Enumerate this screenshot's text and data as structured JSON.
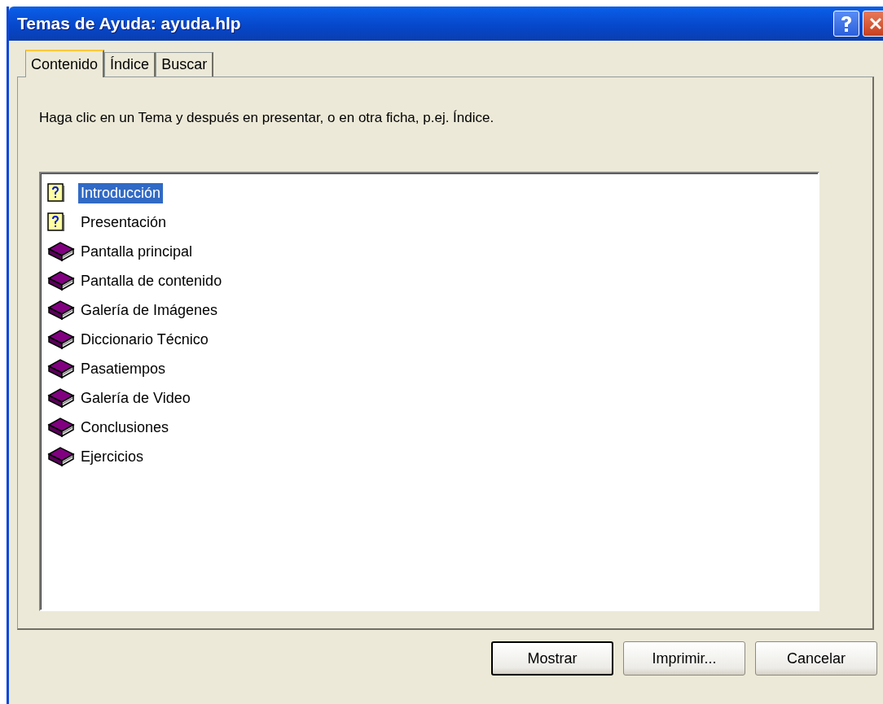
{
  "window": {
    "title": "Temas de Ayuda: ayuda.hlp"
  },
  "tabs": [
    {
      "label": "Contenido",
      "selected": true
    },
    {
      "label": "Índice",
      "selected": false
    },
    {
      "label": "Buscar",
      "selected": false
    }
  ],
  "instructions": "Haga clic en un Tema y después en presentar, o en otra ficha, p.ej. Índice.",
  "topics": [
    {
      "kind": "page",
      "label": "Introducción",
      "selected": true
    },
    {
      "kind": "page",
      "label": "Presentación",
      "selected": false
    },
    {
      "kind": "book",
      "label": "Pantalla principal",
      "selected": false
    },
    {
      "kind": "book",
      "label": "Pantalla de contenido",
      "selected": false
    },
    {
      "kind": "book",
      "label": "Galería de Imágenes",
      "selected": false
    },
    {
      "kind": "book",
      "label": "Diccionario Técnico",
      "selected": false
    },
    {
      "kind": "book",
      "label": "Pasatiempos",
      "selected": false
    },
    {
      "kind": "book",
      "label": "Galería de Video",
      "selected": false
    },
    {
      "kind": "book",
      "label": "Conclusiones",
      "selected": false
    },
    {
      "kind": "book",
      "label": "Ejercicios",
      "selected": false
    }
  ],
  "buttons": [
    {
      "label": "Mostrar",
      "default": true
    },
    {
      "label": "Imprimir...",
      "default": false
    },
    {
      "label": "Cancelar",
      "default": false
    }
  ]
}
